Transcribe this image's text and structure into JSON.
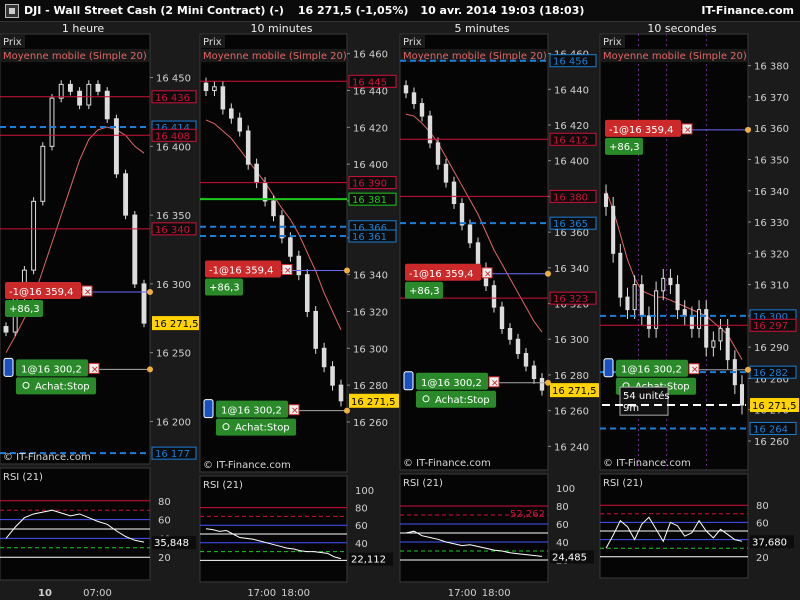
{
  "header": {
    "symbol": "DJI - Wall Street Cash (2 Mini Contract) (-)",
    "price_change": "16 271,5 (-1,05%)",
    "datetime": "10 avr. 2014 19:03 (18:03)",
    "brand": "IT-Finance.com"
  },
  "common": {
    "price_tag": "Prix",
    "ma_label": "Moyenne mobile (Simple 20)",
    "rsi_tag": "RSI (21)",
    "watermark": "© IT-Finance.com",
    "sell_order": "-1@16 359,4",
    "sell_pnl": "+86,3",
    "buy_order": "1@16 300,2",
    "buy_stop": "Achat:Stop",
    "last_price": "16 271,5"
  },
  "colors": {
    "price": "#dddddd",
    "ma": "#e06666",
    "sell": "#cc2a2a",
    "buy": "#2a8a2a",
    "blue_level": "#1a7fd8",
    "red_level": "#d0103a",
    "green_level": "#1ec81e",
    "last_price_bg": "#ffd400"
  },
  "chart_data": [
    {
      "type": "candlestick",
      "title": "1 heure",
      "ylim": [
        16172,
        16470
      ],
      "y_ticks": [
        "16 450",
        "16 400",
        "16 350",
        "16 300",
        "16 250",
        "16 200"
      ],
      "x_ticks": [
        "10",
        "07:00"
      ],
      "series": [
        {
          "name": "Prix",
          "values": [
            16265,
            16290,
            16310,
            16360,
            16400,
            16435,
            16445,
            16440,
            16430,
            16445,
            16440,
            16420,
            16380,
            16350,
            16300,
            16271.5
          ]
        },
        {
          "name": "Moyenne mobile (Simple 20)",
          "values": [
            16250,
            16262,
            16275,
            16290,
            16310,
            16330,
            16350,
            16370,
            16390,
            16405,
            16412,
            16414,
            16412,
            16408,
            16400,
            16395
          ]
        }
      ],
      "price_labels": [
        {
          "text": "16 436",
          "value": 16436,
          "color": "red"
        },
        {
          "text": "16 414",
          "value": 16414,
          "color": "blue"
        },
        {
          "text": "16 408",
          "value": 16408,
          "color": "red"
        },
        {
          "text": "16 340",
          "value": 16340,
          "color": "red"
        },
        {
          "text": "16 177",
          "value": 16177,
          "color": "blue"
        }
      ],
      "rsi": {
        "value_label": "35,848",
        "ticks": [
          "80",
          "60",
          "40",
          "20"
        ],
        "values": [
          40,
          52,
          62,
          66,
          68,
          70,
          67,
          64,
          66,
          62,
          58,
          55,
          48,
          42,
          38,
          36
        ]
      }
    },
    {
      "type": "candlestick",
      "title": "10 minutes",
      "ylim": [
        16235,
        16462
      ],
      "y_ticks": [
        "16 460",
        "16 440",
        "16 420",
        "16 400",
        "16 380",
        "16 360",
        "16 340",
        "16 320",
        "16 300",
        "16 280",
        "16 260"
      ],
      "x_ticks": [
        "17:00",
        "18:00"
      ],
      "series": [
        {
          "name": "Prix",
          "values": [
            16440,
            16442,
            16430,
            16425,
            16418,
            16400,
            16390,
            16380,
            16372,
            16360,
            16350,
            16340,
            16320,
            16300,
            16290,
            16280,
            16271.5
          ]
        },
        {
          "name": "Moyenne mobile (Simple 20)",
          "values": [
            16424,
            16422,
            16418,
            16414,
            16408,
            16402,
            16396,
            16390,
            16383,
            16376,
            16370,
            16362,
            16352,
            16342,
            16330,
            16320,
            16310
          ]
        }
      ],
      "price_labels": [
        {
          "text": "16 445",
          "value": 16445,
          "color": "red"
        },
        {
          "text": "16 390",
          "value": 16390,
          "color": "red"
        },
        {
          "text": "16 381",
          "value": 16381,
          "color": "green"
        },
        {
          "text": "16 366",
          "value": 16366,
          "color": "blue"
        },
        {
          "text": "16 361",
          "value": 16361,
          "color": "blue"
        }
      ],
      "rsi": {
        "value_label": "22,112",
        "ticks": [
          "100",
          "80",
          "60",
          "40",
          "20"
        ],
        "values": [
          56,
          55,
          53,
          54,
          50,
          46,
          45,
          44,
          42,
          40,
          38,
          36,
          34,
          33,
          31,
          30,
          30,
          29,
          28,
          24,
          22
        ]
      }
    },
    {
      "type": "candlestick",
      "title": "5 minutes",
      "ylim": [
        16229,
        16462
      ],
      "y_ticks": [
        "16 460",
        "16 440",
        "16 420",
        "16 400",
        "16 380",
        "16 360",
        "16 340",
        "16 320",
        "16 300",
        "16 280",
        "16 260",
        "16 240"
      ],
      "x_ticks": [
        "17:00",
        "18:00"
      ],
      "series": [
        {
          "name": "Prix",
          "values": [
            16438,
            16432,
            16425,
            16410,
            16398,
            16388,
            16376,
            16364,
            16354,
            16340,
            16330,
            16318,
            16306,
            16300,
            16292,
            16285,
            16278,
            16271.5
          ]
        },
        {
          "name": "Moyenne mobile (Simple 20)",
          "values": [
            16426,
            16425,
            16421,
            16416,
            16410,
            16402,
            16394,
            16386,
            16378,
            16370,
            16360,
            16350,
            16342,
            16334,
            16326,
            16318,
            16310,
            16304
          ]
        }
      ],
      "price_labels": [
        {
          "text": "16 456",
          "value": 16456,
          "color": "blue"
        },
        {
          "text": "16 412",
          "value": 16412,
          "color": "red"
        },
        {
          "text": "16 380",
          "value": 16380,
          "color": "red"
        },
        {
          "text": "16 365",
          "value": 16365,
          "color": "blue"
        },
        {
          "text": "16 323",
          "value": 16323,
          "color": "red"
        }
      ],
      "rsi": {
        "value_label": "24,485",
        "ref_label": "52,262",
        "ticks": [
          "100",
          "80",
          "60",
          "40",
          "20"
        ],
        "values": [
          50,
          52,
          47,
          45,
          43,
          40,
          38,
          36,
          37,
          35,
          33,
          31,
          30,
          28,
          27,
          26,
          25,
          24
        ]
      }
    },
    {
      "type": "candlestick",
      "title": "10 secondes",
      "ylim": [
        16252,
        16385
      ],
      "y_ticks": [
        "16 380",
        "16 370",
        "16 360",
        "16 350",
        "16 340",
        "16 330",
        "16 320",
        "16 310",
        "16 300",
        "16 290",
        "16 280",
        "16 270",
        "16 260"
      ],
      "x_ticks": [],
      "series": [
        {
          "name": "Prix",
          "values": [
            16335,
            16320,
            16306,
            16302,
            16310,
            16300,
            16296,
            16308,
            16312,
            16310,
            16302,
            16300,
            16296,
            16302,
            16290,
            16292,
            16296,
            16286,
            16278,
            16271.5
          ]
        },
        {
          "name": "Moyenne mobile (Simple 20)",
          "values": [
            16340,
            16334,
            16326,
            16318,
            16312,
            16308,
            16307,
            16306,
            16306,
            16305,
            16304,
            16303,
            16302,
            16301,
            16300,
            16298,
            16296,
            16294,
            16290,
            16286
          ]
        }
      ],
      "price_labels": [
        {
          "text": "16 300",
          "value": 16300,
          "color": "blue"
        },
        {
          "text": "16 297",
          "value": 16297,
          "color": "red"
        },
        {
          "text": "16 282",
          "value": 16282,
          "color": "blue"
        },
        {
          "text": "16 264",
          "value": 16264,
          "color": "blue"
        }
      ],
      "annotation": {
        "line1": "54 unités",
        "line2": "9m"
      },
      "rsi": {
        "value_label": "37,680",
        "ticks": [
          "80",
          "60",
          "40",
          "20"
        ],
        "values": [
          30,
          45,
          62,
          55,
          40,
          58,
          66,
          52,
          38,
          60,
          56,
          44,
          48,
          62,
          50,
          42,
          52,
          46,
          40,
          38
        ]
      }
    }
  ]
}
